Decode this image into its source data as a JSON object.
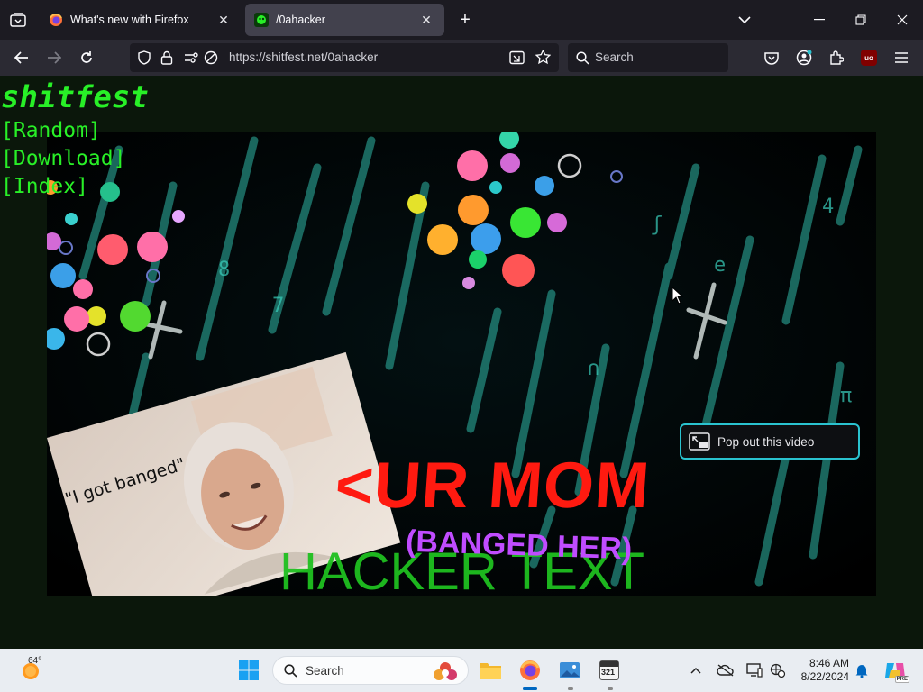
{
  "browser": {
    "tabs": [
      {
        "title": "What's new with Firefox",
        "active": false
      },
      {
        "title": "/0ahacker",
        "active": true
      }
    ],
    "url": "https://shitfest.net/0ahacker",
    "search_placeholder": "Search",
    "extension_badge": "uo"
  },
  "page": {
    "site_title": "shitfest",
    "links": [
      "[Random]",
      "[Download]",
      "[Index]"
    ],
    "video": {
      "caption_quote": "\"I got banged\"",
      "headline": "<UR MOM",
      "subline": "(BANGED HER)",
      "bottom_text": "HACKER TEXT"
    },
    "popout_label": "Pop out this video"
  },
  "taskbar": {
    "weather_temp": "64°",
    "search_placeholder": "Search",
    "time": "8:46 AM",
    "date": "8/22/2024",
    "calendar_number": "321",
    "copilot_badge": "PRE"
  },
  "colors": {
    "site_green": "#28f027",
    "headline_red": "#ff1a10",
    "subline_purple": "#c04cff",
    "hacker_green": "#20c020",
    "accent_cyan": "#2ac3d0"
  }
}
